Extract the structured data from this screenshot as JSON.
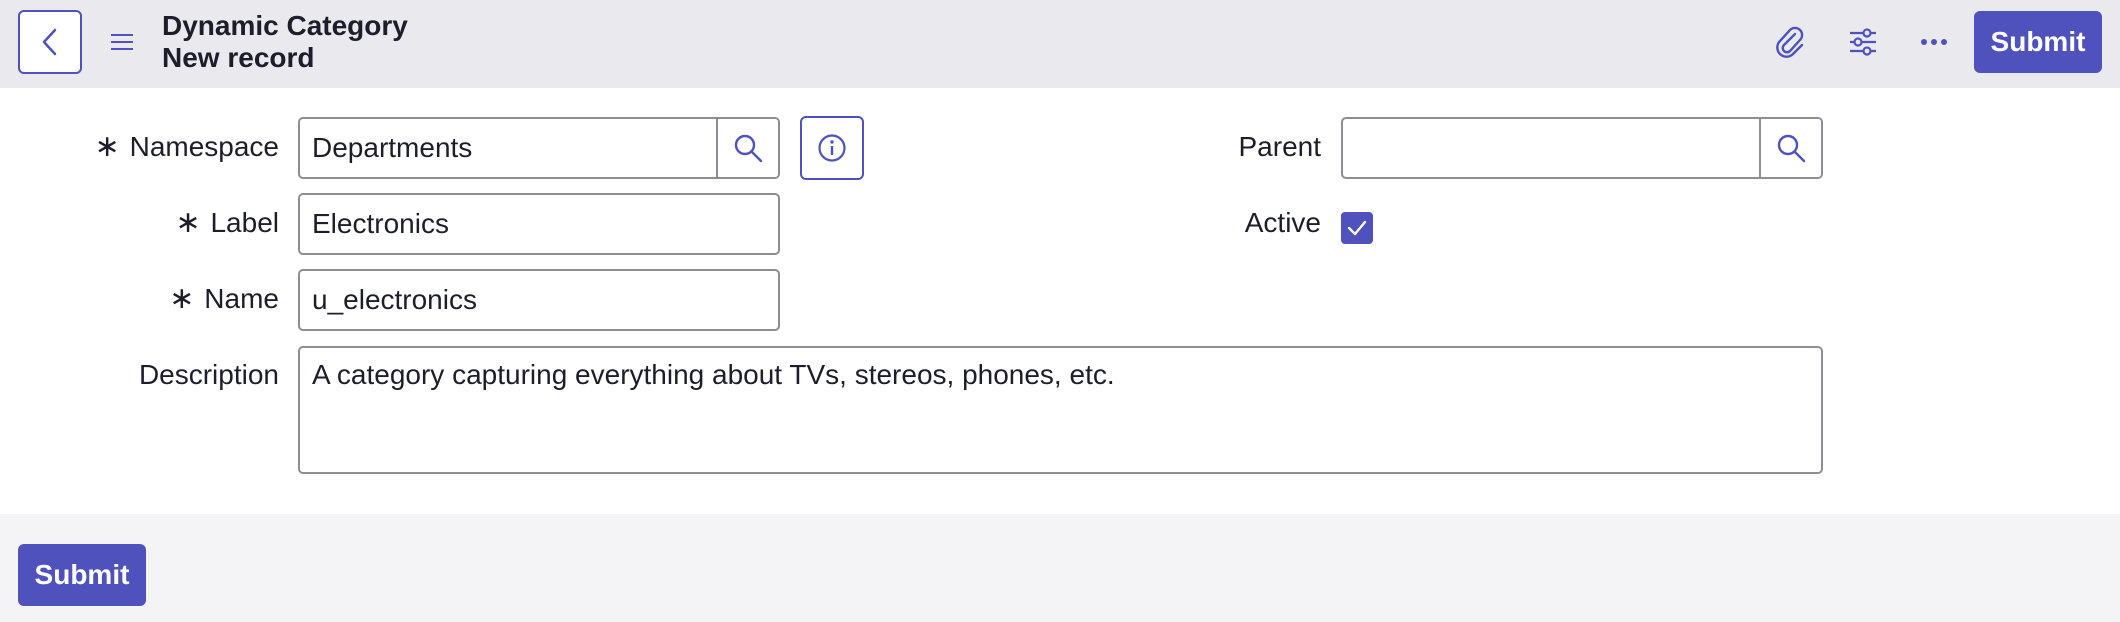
{
  "header": {
    "title": "Dynamic Category",
    "subtitle": "New record",
    "submit_label": "Submit",
    "icons": [
      "chevron-left-icon",
      "hamburger-menu-icon",
      "paperclip-icon",
      "sliders-icon",
      "more-icon"
    ]
  },
  "form": {
    "namespace": {
      "label": "Namespace",
      "value": "Departments",
      "required": "∗"
    },
    "label": {
      "label": "Label",
      "value": "Electronics",
      "required": "∗"
    },
    "name": {
      "label": "Name",
      "value": "u_electronics",
      "required": "∗"
    },
    "description": {
      "label": "Description",
      "value": "A category capturing everything about TVs, stereos, phones, etc."
    },
    "parent": {
      "label": "Parent",
      "value": ""
    },
    "active": {
      "label": "Active",
      "checked": true
    }
  },
  "footer": {
    "submit_label": "Submit"
  },
  "colors": {
    "accent": "#4f52bd",
    "header_bg": "#e9e9ee",
    "page_bg": "#f4f4f6",
    "border": "#8d8d96"
  }
}
